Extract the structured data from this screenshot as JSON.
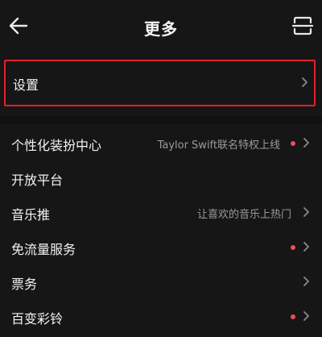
{
  "header": {
    "title": "更多",
    "back_icon": "arrow-left-icon",
    "scan_icon": "scan-icon"
  },
  "settings": {
    "label": "设置",
    "highlight_color": "#e3202c"
  },
  "items": [
    {
      "label": "个性化装扮中心",
      "subtitle": "Taylor Swift联名特权上线",
      "dot": true
    },
    {
      "label": "开放平台",
      "subtitle": "",
      "dot": false
    },
    {
      "label": "音乐推",
      "subtitle": "让喜欢的音乐上热门",
      "dot": false
    },
    {
      "label": "免流量服务",
      "subtitle": "",
      "dot": true
    },
    {
      "label": "票务",
      "subtitle": "",
      "dot": false
    },
    {
      "label": "百变彩铃",
      "subtitle": "",
      "dot": true
    }
  ],
  "colors": {
    "background": "#161616",
    "dot": "#ef4b57",
    "text": "#f2f2f2",
    "subtext": "#9a9a9a"
  }
}
